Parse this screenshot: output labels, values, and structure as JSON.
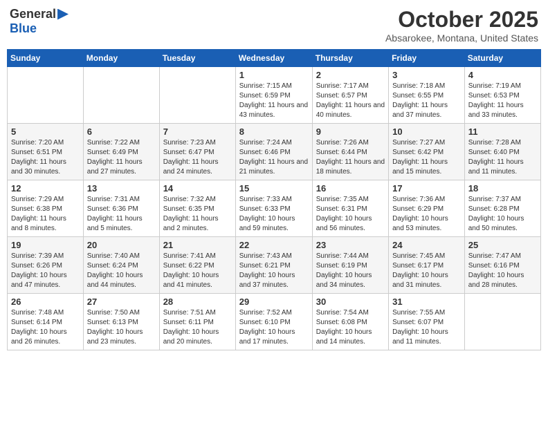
{
  "header": {
    "logo_general": "General",
    "logo_blue": "Blue",
    "month_title": "October 2025",
    "location": "Absarokee, Montana, United States"
  },
  "days_of_week": [
    "Sunday",
    "Monday",
    "Tuesday",
    "Wednesday",
    "Thursday",
    "Friday",
    "Saturday"
  ],
  "weeks": [
    [
      {
        "day": "",
        "info": ""
      },
      {
        "day": "",
        "info": ""
      },
      {
        "day": "",
        "info": ""
      },
      {
        "day": "1",
        "info": "Sunrise: 7:15 AM\nSunset: 6:59 PM\nDaylight: 11 hours and 43 minutes."
      },
      {
        "day": "2",
        "info": "Sunrise: 7:17 AM\nSunset: 6:57 PM\nDaylight: 11 hours and 40 minutes."
      },
      {
        "day": "3",
        "info": "Sunrise: 7:18 AM\nSunset: 6:55 PM\nDaylight: 11 hours and 37 minutes."
      },
      {
        "day": "4",
        "info": "Sunrise: 7:19 AM\nSunset: 6:53 PM\nDaylight: 11 hours and 33 minutes."
      }
    ],
    [
      {
        "day": "5",
        "info": "Sunrise: 7:20 AM\nSunset: 6:51 PM\nDaylight: 11 hours and 30 minutes."
      },
      {
        "day": "6",
        "info": "Sunrise: 7:22 AM\nSunset: 6:49 PM\nDaylight: 11 hours and 27 minutes."
      },
      {
        "day": "7",
        "info": "Sunrise: 7:23 AM\nSunset: 6:47 PM\nDaylight: 11 hours and 24 minutes."
      },
      {
        "day": "8",
        "info": "Sunrise: 7:24 AM\nSunset: 6:46 PM\nDaylight: 11 hours and 21 minutes."
      },
      {
        "day": "9",
        "info": "Sunrise: 7:26 AM\nSunset: 6:44 PM\nDaylight: 11 hours and 18 minutes."
      },
      {
        "day": "10",
        "info": "Sunrise: 7:27 AM\nSunset: 6:42 PM\nDaylight: 11 hours and 15 minutes."
      },
      {
        "day": "11",
        "info": "Sunrise: 7:28 AM\nSunset: 6:40 PM\nDaylight: 11 hours and 11 minutes."
      }
    ],
    [
      {
        "day": "12",
        "info": "Sunrise: 7:29 AM\nSunset: 6:38 PM\nDaylight: 11 hours and 8 minutes."
      },
      {
        "day": "13",
        "info": "Sunrise: 7:31 AM\nSunset: 6:36 PM\nDaylight: 11 hours and 5 minutes."
      },
      {
        "day": "14",
        "info": "Sunrise: 7:32 AM\nSunset: 6:35 PM\nDaylight: 11 hours and 2 minutes."
      },
      {
        "day": "15",
        "info": "Sunrise: 7:33 AM\nSunset: 6:33 PM\nDaylight: 10 hours and 59 minutes."
      },
      {
        "day": "16",
        "info": "Sunrise: 7:35 AM\nSunset: 6:31 PM\nDaylight: 10 hours and 56 minutes."
      },
      {
        "day": "17",
        "info": "Sunrise: 7:36 AM\nSunset: 6:29 PM\nDaylight: 10 hours and 53 minutes."
      },
      {
        "day": "18",
        "info": "Sunrise: 7:37 AM\nSunset: 6:28 PM\nDaylight: 10 hours and 50 minutes."
      }
    ],
    [
      {
        "day": "19",
        "info": "Sunrise: 7:39 AM\nSunset: 6:26 PM\nDaylight: 10 hours and 47 minutes."
      },
      {
        "day": "20",
        "info": "Sunrise: 7:40 AM\nSunset: 6:24 PM\nDaylight: 10 hours and 44 minutes."
      },
      {
        "day": "21",
        "info": "Sunrise: 7:41 AM\nSunset: 6:22 PM\nDaylight: 10 hours and 41 minutes."
      },
      {
        "day": "22",
        "info": "Sunrise: 7:43 AM\nSunset: 6:21 PM\nDaylight: 10 hours and 37 minutes."
      },
      {
        "day": "23",
        "info": "Sunrise: 7:44 AM\nSunset: 6:19 PM\nDaylight: 10 hours and 34 minutes."
      },
      {
        "day": "24",
        "info": "Sunrise: 7:45 AM\nSunset: 6:17 PM\nDaylight: 10 hours and 31 minutes."
      },
      {
        "day": "25",
        "info": "Sunrise: 7:47 AM\nSunset: 6:16 PM\nDaylight: 10 hours and 28 minutes."
      }
    ],
    [
      {
        "day": "26",
        "info": "Sunrise: 7:48 AM\nSunset: 6:14 PM\nDaylight: 10 hours and 26 minutes."
      },
      {
        "day": "27",
        "info": "Sunrise: 7:50 AM\nSunset: 6:13 PM\nDaylight: 10 hours and 23 minutes."
      },
      {
        "day": "28",
        "info": "Sunrise: 7:51 AM\nSunset: 6:11 PM\nDaylight: 10 hours and 20 minutes."
      },
      {
        "day": "29",
        "info": "Sunrise: 7:52 AM\nSunset: 6:10 PM\nDaylight: 10 hours and 17 minutes."
      },
      {
        "day": "30",
        "info": "Sunrise: 7:54 AM\nSunset: 6:08 PM\nDaylight: 10 hours and 14 minutes."
      },
      {
        "day": "31",
        "info": "Sunrise: 7:55 AM\nSunset: 6:07 PM\nDaylight: 10 hours and 11 minutes."
      },
      {
        "day": "",
        "info": ""
      }
    ]
  ]
}
